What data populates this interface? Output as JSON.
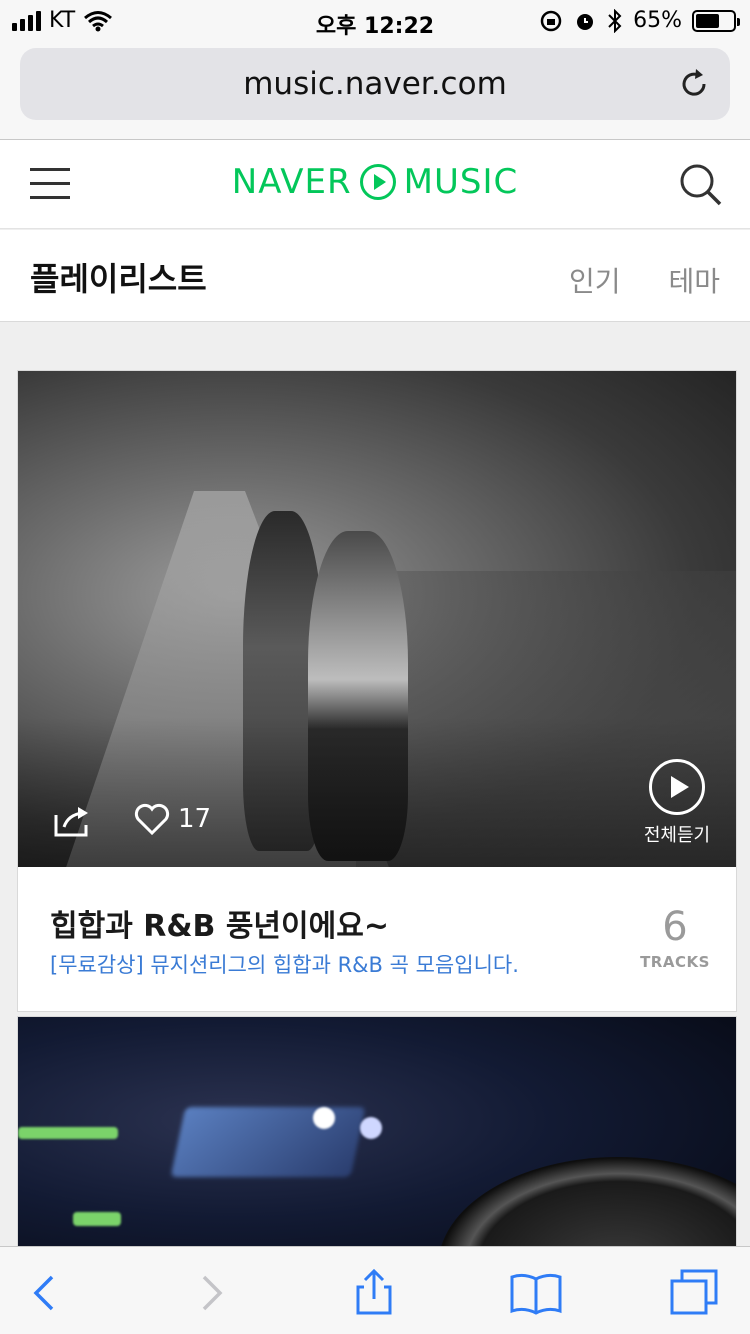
{
  "status_bar": {
    "carrier": "KT",
    "time": "오후 12:22",
    "battery_percent": "65%",
    "battery_level": 0.65
  },
  "browser": {
    "url": "music.naver.com"
  },
  "header": {
    "logo_left": "NAVER",
    "logo_right": "MUSIC"
  },
  "section": {
    "title": "플레이리스트",
    "tabs": [
      {
        "label": "인기"
      },
      {
        "label": "테마"
      }
    ]
  },
  "playlist": {
    "likes": "17",
    "play_all_label": "전체듣기",
    "title": "힙합과 R&B 풍년이에요~",
    "description": "[무료감상] 뮤지션리그의 힙합과 R&B 곡 모음입니다.",
    "track_count": "6",
    "tracks_label": "TRACKS"
  },
  "colors": {
    "brand_green": "#03c75a",
    "link_blue": "#3a7bd5",
    "ios_blue": "#2f7cf6"
  }
}
